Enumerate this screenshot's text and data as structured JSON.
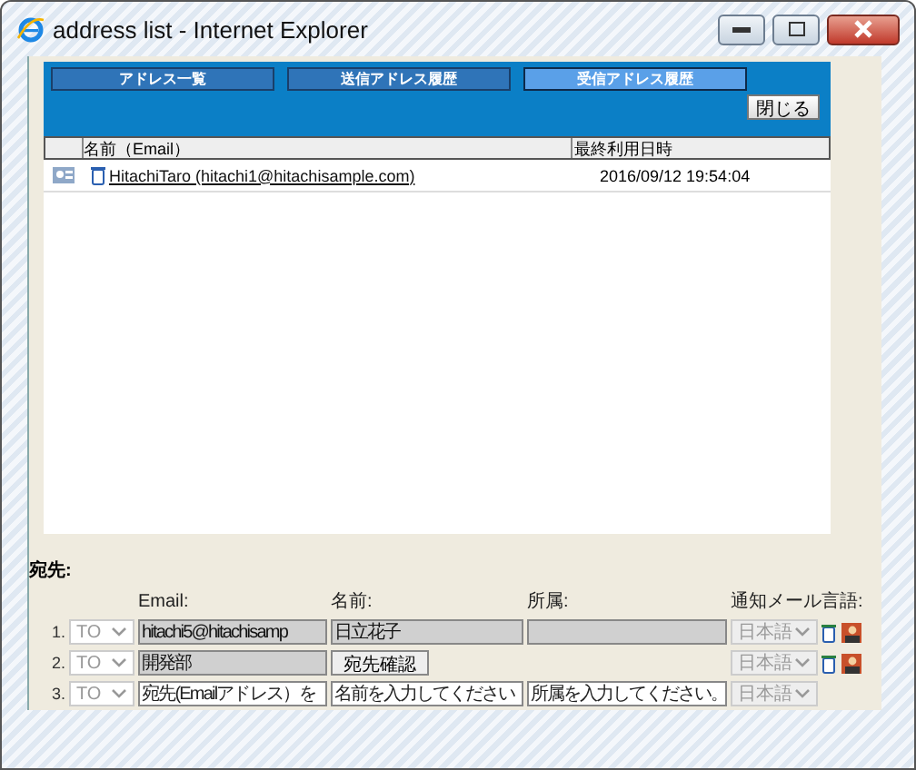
{
  "window": {
    "title": "address list - Internet Explorer"
  },
  "tabs": [
    {
      "label": "アドレス一覧",
      "selected": false
    },
    {
      "label": "送信アドレス履歴",
      "selected": false
    },
    {
      "label": "受信アドレス履歴",
      "selected": true
    }
  ],
  "close_button": "閉じる",
  "table": {
    "columns": [
      "名前（Email）",
      "最終利用日時"
    ],
    "rows": [
      {
        "name": "HitachiTaro (hitachi1@hitachisample.com)",
        "last_used": "2016/09/12 19:54:04"
      }
    ]
  },
  "recipients_label": "宛先:",
  "field_labels": [
    "Email:",
    "名前:",
    "所属:",
    "通知メール言語:"
  ],
  "recipients": [
    {
      "index": "1.",
      "type": "TO",
      "email": {
        "value": "hitachi5@hitachisamp",
        "disabled": true
      },
      "name": {
        "kind": "field",
        "value": "日立花子",
        "disabled": true
      },
      "affiliation": {
        "disabled": true
      },
      "language": "日本語",
      "actions": true
    },
    {
      "index": "2.",
      "type": "TO",
      "email": {
        "value": "開発部",
        "disabled": true
      },
      "name": {
        "kind": "button",
        "label": "宛先確認"
      },
      "language": "日本語",
      "actions": true
    },
    {
      "index": "3.",
      "type": "TO",
      "email": {
        "placeholder": "宛先(Emailアドレス）を",
        "disabled": false
      },
      "name": {
        "kind": "field",
        "placeholder": "名前を入力してください",
        "disabled": false
      },
      "affiliation": {
        "placeholder": "所属を入力してください。",
        "disabled": false
      },
      "language": "日本語",
      "actions": false
    }
  ]
}
